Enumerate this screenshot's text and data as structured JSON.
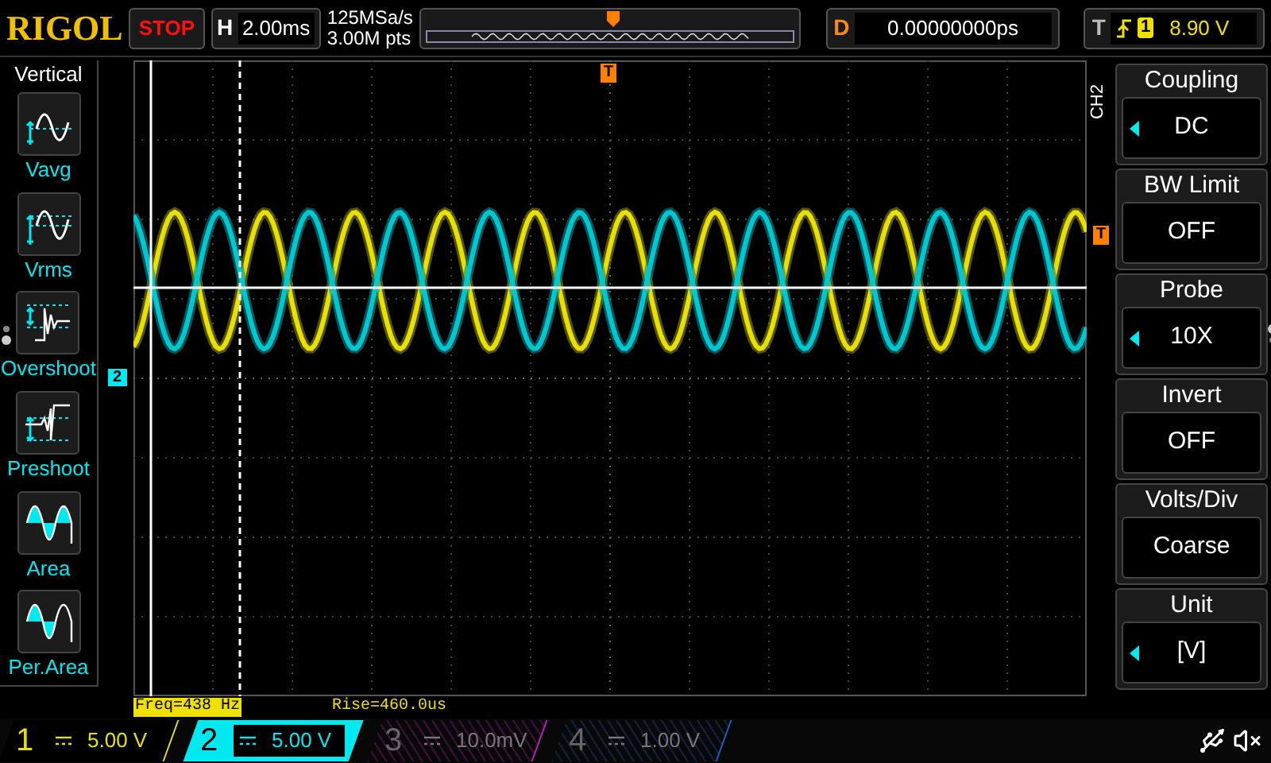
{
  "brand": "RIGOL",
  "run_state": "STOP",
  "horizontal": {
    "label": "H",
    "value": "2.00ms"
  },
  "acquisition": {
    "sample_rate": "125MSa/s",
    "memory_depth": "3.00M pts"
  },
  "delay": {
    "label": "D",
    "value": "0.00000000ps"
  },
  "trigger": {
    "label": "T",
    "source": "1",
    "level": "8.90 V"
  },
  "left_menu": {
    "title": "Vertical",
    "items": [
      {
        "kind": "vavg",
        "label": "Vavg"
      },
      {
        "kind": "vrms",
        "label": "Vrms"
      },
      {
        "kind": "overshoot",
        "label": "Overshoot"
      },
      {
        "kind": "preshoot",
        "label": "Preshoot"
      },
      {
        "kind": "area",
        "label": "Area"
      },
      {
        "kind": "perarea",
        "label": "Per.Area"
      }
    ]
  },
  "grid": {
    "channel_marker": "2",
    "trigger_top_marker": "T",
    "trigger_right_marker": "T"
  },
  "measurements": [
    {
      "text": "Freq=438 Hz",
      "selected": true
    },
    {
      "text": "Rise=460.0us",
      "selected": false
    }
  ],
  "right_menu": {
    "channel": "CH2",
    "items": [
      {
        "title": "Coupling",
        "value": "DC",
        "arrow": true
      },
      {
        "title": "BW Limit",
        "value": "OFF",
        "arrow": false
      },
      {
        "title": "Probe",
        "value": "10X",
        "arrow": true
      },
      {
        "title": "Invert",
        "value": "OFF",
        "arrow": false
      },
      {
        "title": "Volts/Div",
        "value": "Coarse",
        "arrow": false
      },
      {
        "title": "Unit",
        "value": "[V]",
        "arrow": true
      }
    ]
  },
  "channels": [
    {
      "number": "1",
      "value": "5.00 V",
      "color": "#e8e000",
      "enabled": true,
      "selected": false
    },
    {
      "number": "2",
      "value": "5.00 V",
      "color": "#00e8f0",
      "enabled": true,
      "selected": true
    },
    {
      "number": "3",
      "value": "10.0mV",
      "color": "#c020c0",
      "enabled": false,
      "selected": false
    },
    {
      "number": "4",
      "value": "1.00 V",
      "color": "#2060c0",
      "enabled": false,
      "selected": false
    }
  ]
}
